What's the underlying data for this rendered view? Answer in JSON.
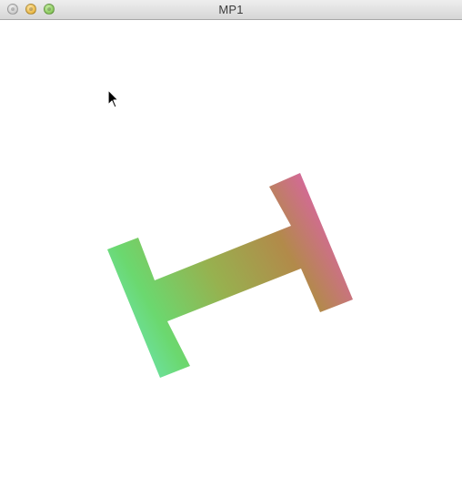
{
  "window": {
    "title": "MP1"
  },
  "icons": {
    "close": "close-icon",
    "minimize": "minimize-icon",
    "zoom": "zoom-icon",
    "cursor": "cursor-arrow-icon"
  },
  "colors": {
    "shape_green": "#6bd86f",
    "shape_teal": "#6ee7c3",
    "shape_olive": "#97b14f",
    "shape_brown": "#b28a4a",
    "shape_magenta": "#e05ccf",
    "shape_rose": "#d06d8e"
  }
}
